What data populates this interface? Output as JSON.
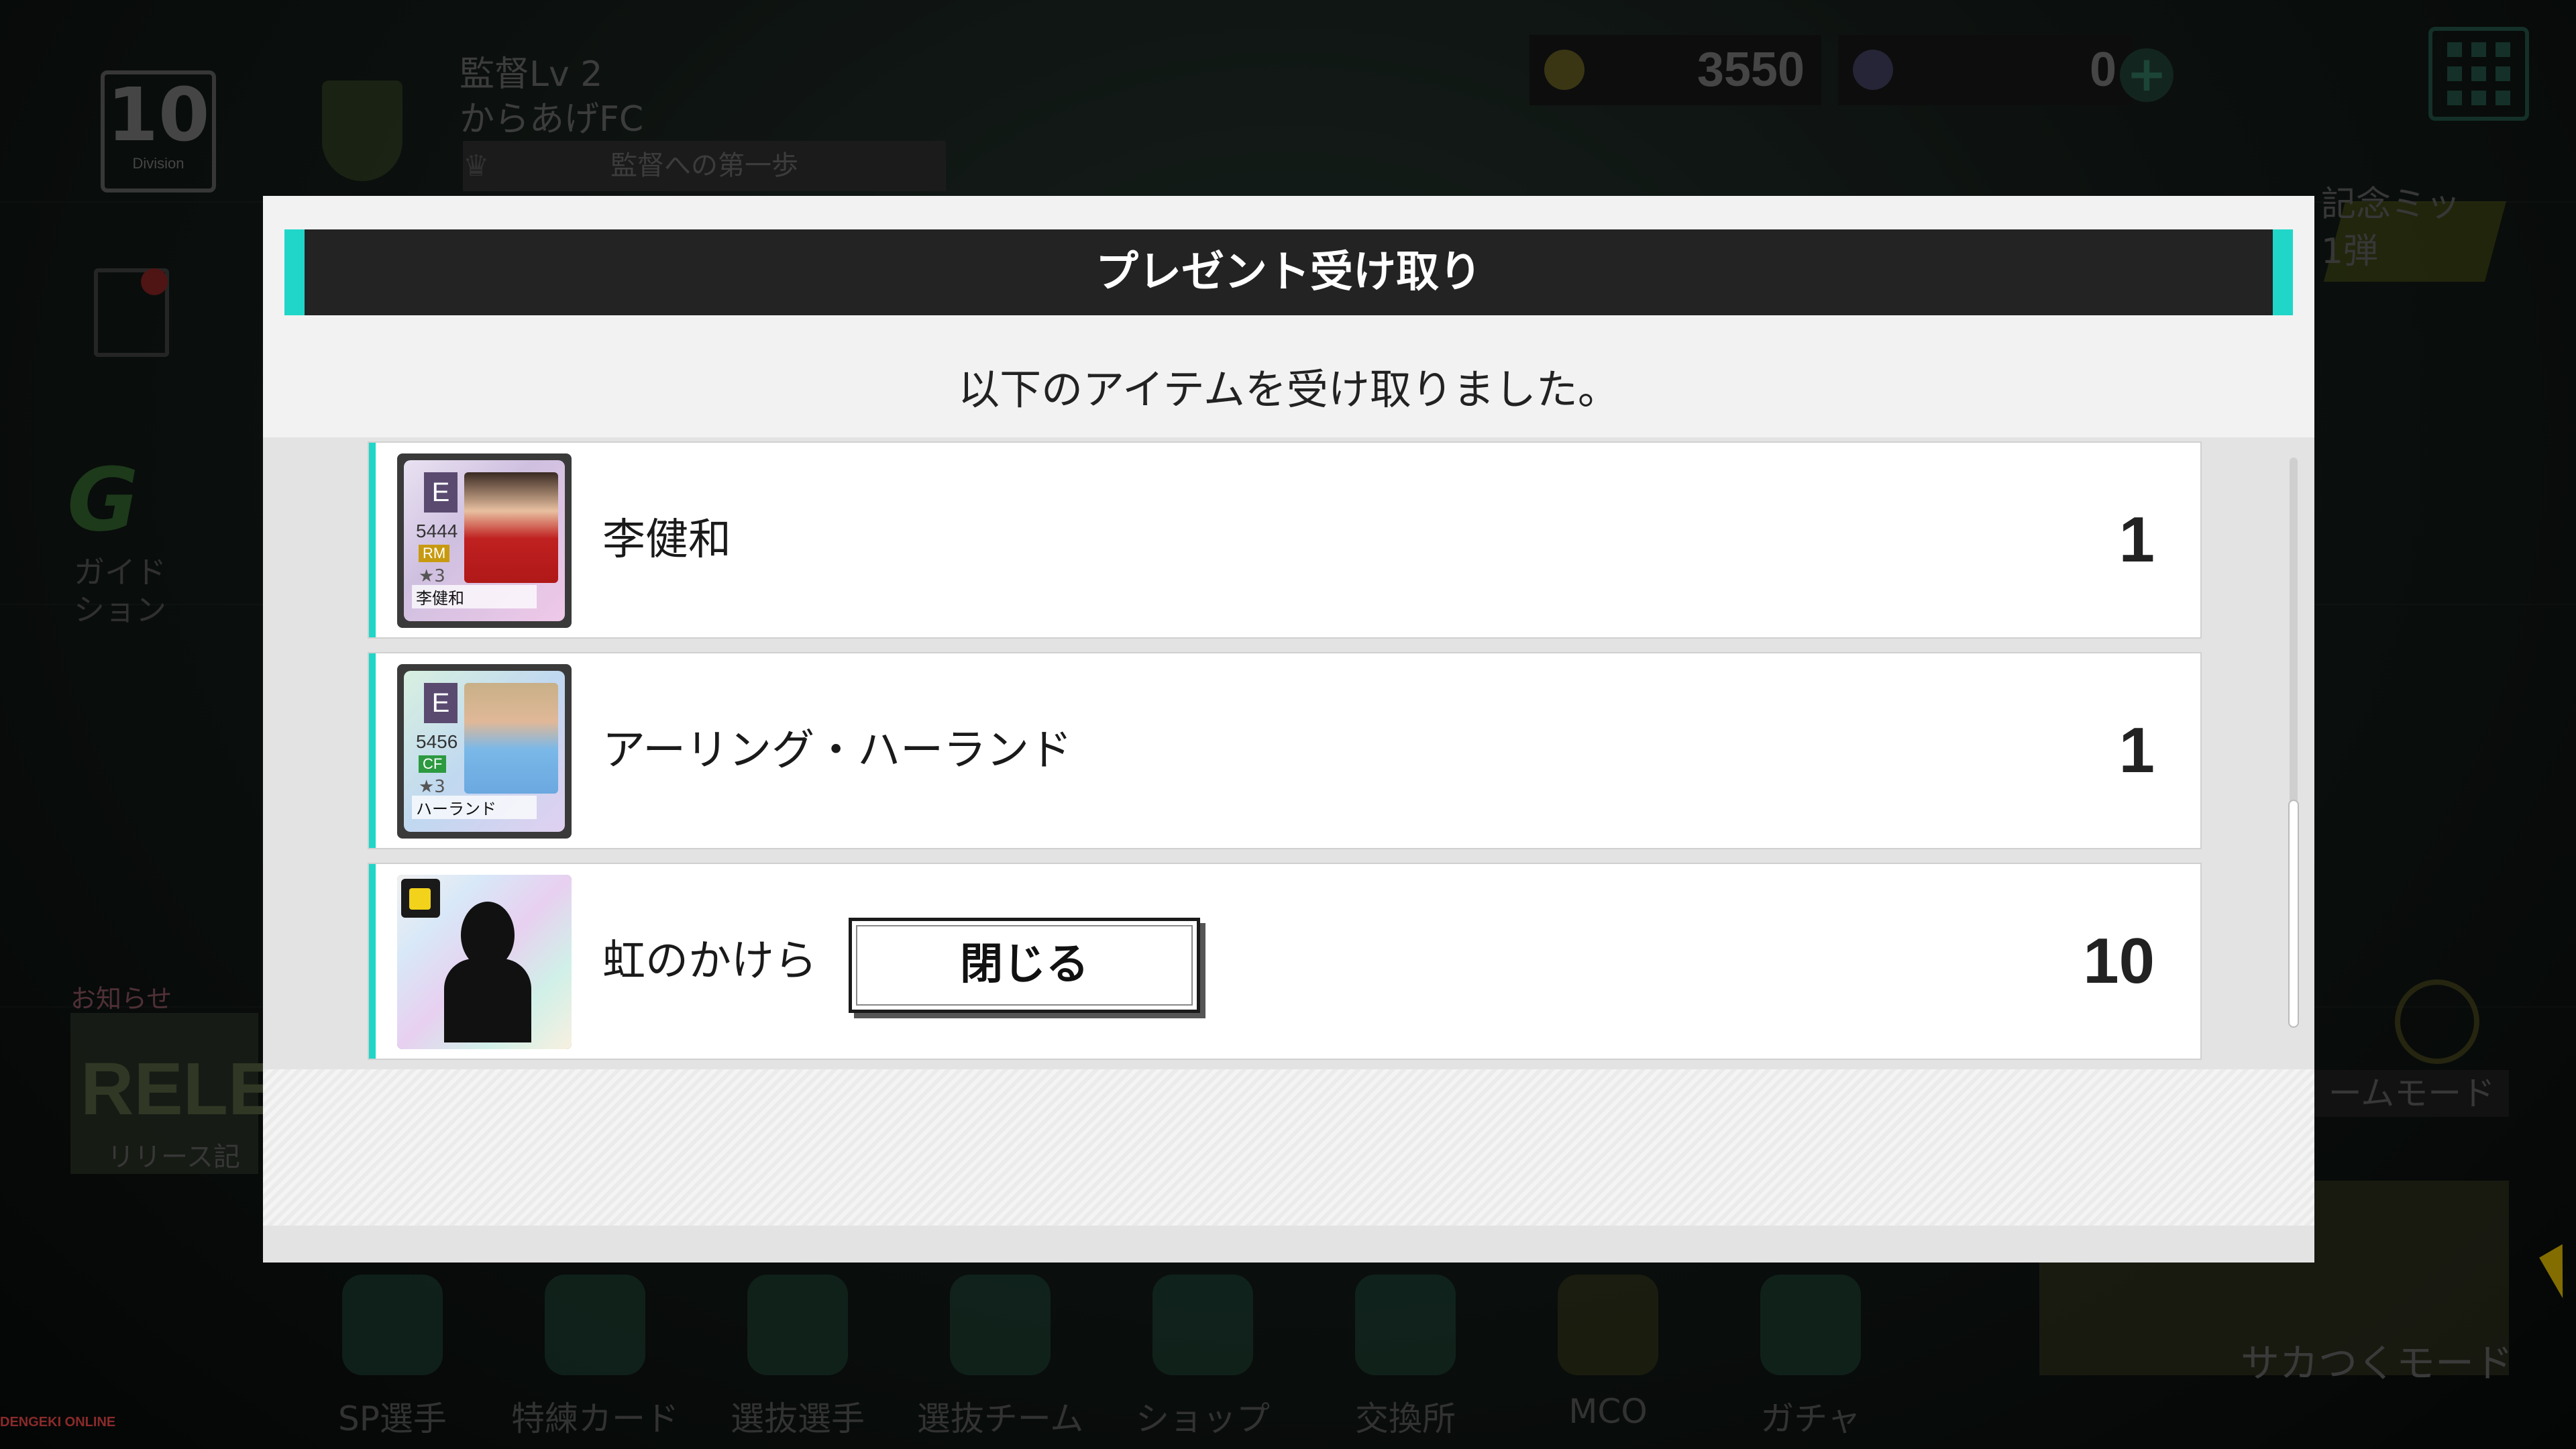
{
  "hud": {
    "division_number": "10",
    "division_label": "Division",
    "coach_level": "監督Lv 2",
    "club_name": "からあげFC",
    "title": "監督への第一歩",
    "coins": "3550",
    "gems": "0",
    "plus_symbol": "+"
  },
  "background": {
    "mission_text_1": "記念ミッ",
    "mission_text_2": "1弾",
    "guide_label_1": "ガイド",
    "guide_label_2": "ション",
    "news_label": "お知らせ",
    "news_big": "RELE",
    "news_sub": "リリース記",
    "team_mode": "ームモード",
    "sakatsuku_mode": "サカつくモード"
  },
  "bottom_nav": [
    {
      "label": "SP選手"
    },
    {
      "label": "特練カード"
    },
    {
      "label": "選抜選手"
    },
    {
      "label": "選抜チーム"
    },
    {
      "label": "ショップ"
    },
    {
      "label": "交換所"
    },
    {
      "label": "MCO"
    },
    {
      "label": "ガチャ"
    }
  ],
  "modal": {
    "title": "プレゼント受け取り",
    "message": "以下のアイテムを受け取りました。",
    "close_label": "閉じる",
    "items": [
      {
        "name": "李健和",
        "quantity": "1",
        "card": {
          "rank": "E",
          "ovr": "5444",
          "position": "RM",
          "stars": "★3",
          "name": "李健和"
        }
      },
      {
        "name": "アーリング・ハーランド",
        "quantity": "1",
        "card": {
          "rank": "E",
          "ovr": "5456",
          "position": "CF",
          "stars": "★3",
          "name": "ハーランド"
        }
      },
      {
        "name": "虹のかけら",
        "quantity": "10"
      }
    ]
  },
  "watermark": "DENGEKI ONLINE",
  "colors": {
    "accent": "#1fd6c8",
    "header_bg": "#232323",
    "modal_bg": "#f2f2f2"
  }
}
